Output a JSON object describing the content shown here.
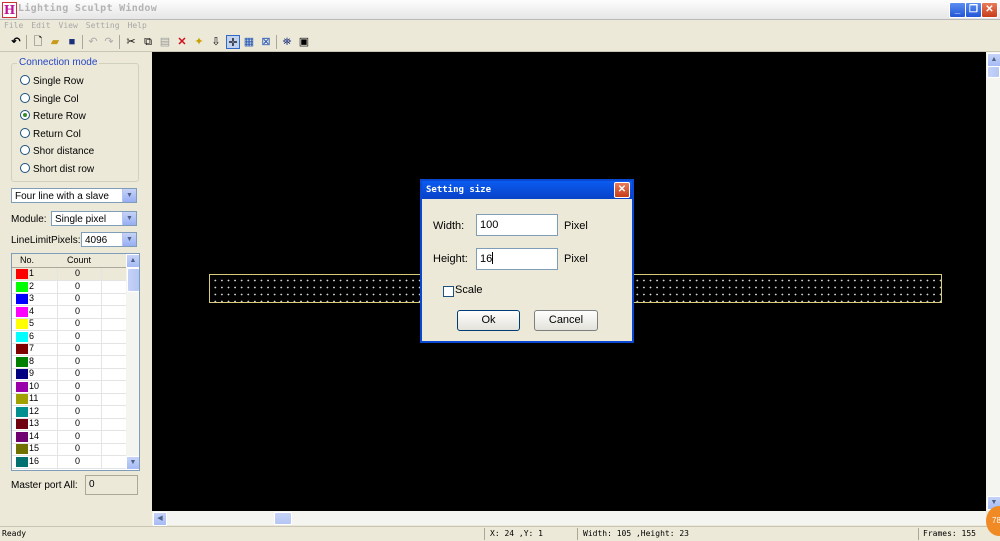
{
  "window": {
    "title": "Lighting Sculpt Window",
    "app_icon": "H",
    "buttons": [
      "_",
      "❐",
      "✕"
    ]
  },
  "menu": [
    "File",
    "Edit",
    "View",
    "Setting",
    "Help"
  ],
  "toolbar": {
    "icons": [
      "undo-icon",
      "new-file-icon",
      "open-folder-icon",
      "save-icon",
      "undo-gray-icon",
      "redo-gray-icon",
      "cut-icon",
      "copy-icon",
      "paste-icon",
      "delete-icon",
      "sparkle-icon",
      "arrow-down-icon",
      "crosshair-icon",
      "grid-icon",
      "fit-icon",
      "binoculars-icon",
      "image-icon"
    ]
  },
  "left": {
    "connection_mode_label": "Connection mode",
    "radios": [
      {
        "label": "Single Row",
        "checked": false
      },
      {
        "label": "Single Col",
        "checked": false
      },
      {
        "label": "Reture Row",
        "checked": true
      },
      {
        "label": "Return Col",
        "checked": false
      },
      {
        "label": "Shor distance",
        "checked": false
      },
      {
        "label": "Short dist row",
        "checked": false
      }
    ],
    "line_combo": "Four line with a slave",
    "module_label": "Module:",
    "module_value": "Single pixel",
    "line_limit_label": "LineLimitPixels:",
    "line_limit_value": "4096",
    "table_headers": [
      "No.",
      "Count"
    ],
    "ports": [
      {
        "no": "1",
        "count": "0",
        "color": "#ff0000"
      },
      {
        "no": "2",
        "count": "0",
        "color": "#00ff00"
      },
      {
        "no": "3",
        "count": "0",
        "color": "#0000ff"
      },
      {
        "no": "4",
        "count": "0",
        "color": "#ff00ff"
      },
      {
        "no": "5",
        "count": "0",
        "color": "#ffff00"
      },
      {
        "no": "6",
        "count": "0",
        "color": "#00ffff"
      },
      {
        "no": "7",
        "count": "0",
        "color": "#800000"
      },
      {
        "no": "8",
        "count": "0",
        "color": "#008000"
      },
      {
        "no": "9",
        "count": "0",
        "color": "#000080"
      },
      {
        "no": "10",
        "count": "0",
        "color": "#9900aa"
      },
      {
        "no": "11",
        "count": "0",
        "color": "#a0a000"
      },
      {
        "no": "12",
        "count": "0",
        "color": "#009090"
      },
      {
        "no": "13",
        "count": "0",
        "color": "#700010"
      },
      {
        "no": "14",
        "count": "0",
        "color": "#700070"
      },
      {
        "no": "15",
        "count": "0",
        "color": "#707000"
      },
      {
        "no": "16",
        "count": "0",
        "color": "#007070"
      }
    ],
    "master_port_label": "Master port All:",
    "master_port_value": "0"
  },
  "dialog": {
    "title": "Setting size",
    "width_label": "Width:",
    "width_value": "100",
    "height_label": "Height:",
    "height_value": "16",
    "unit": "Pixel",
    "scale_label": "Scale",
    "scale_checked": false,
    "ok_label": "Ok",
    "cancel_label": "Cancel"
  },
  "status": {
    "ready": "Ready",
    "coords": "X: 24 ,Y: 1",
    "size": "Width: 105 ,Height: 23",
    "frames": "Frames: 155"
  },
  "badge": "78"
}
